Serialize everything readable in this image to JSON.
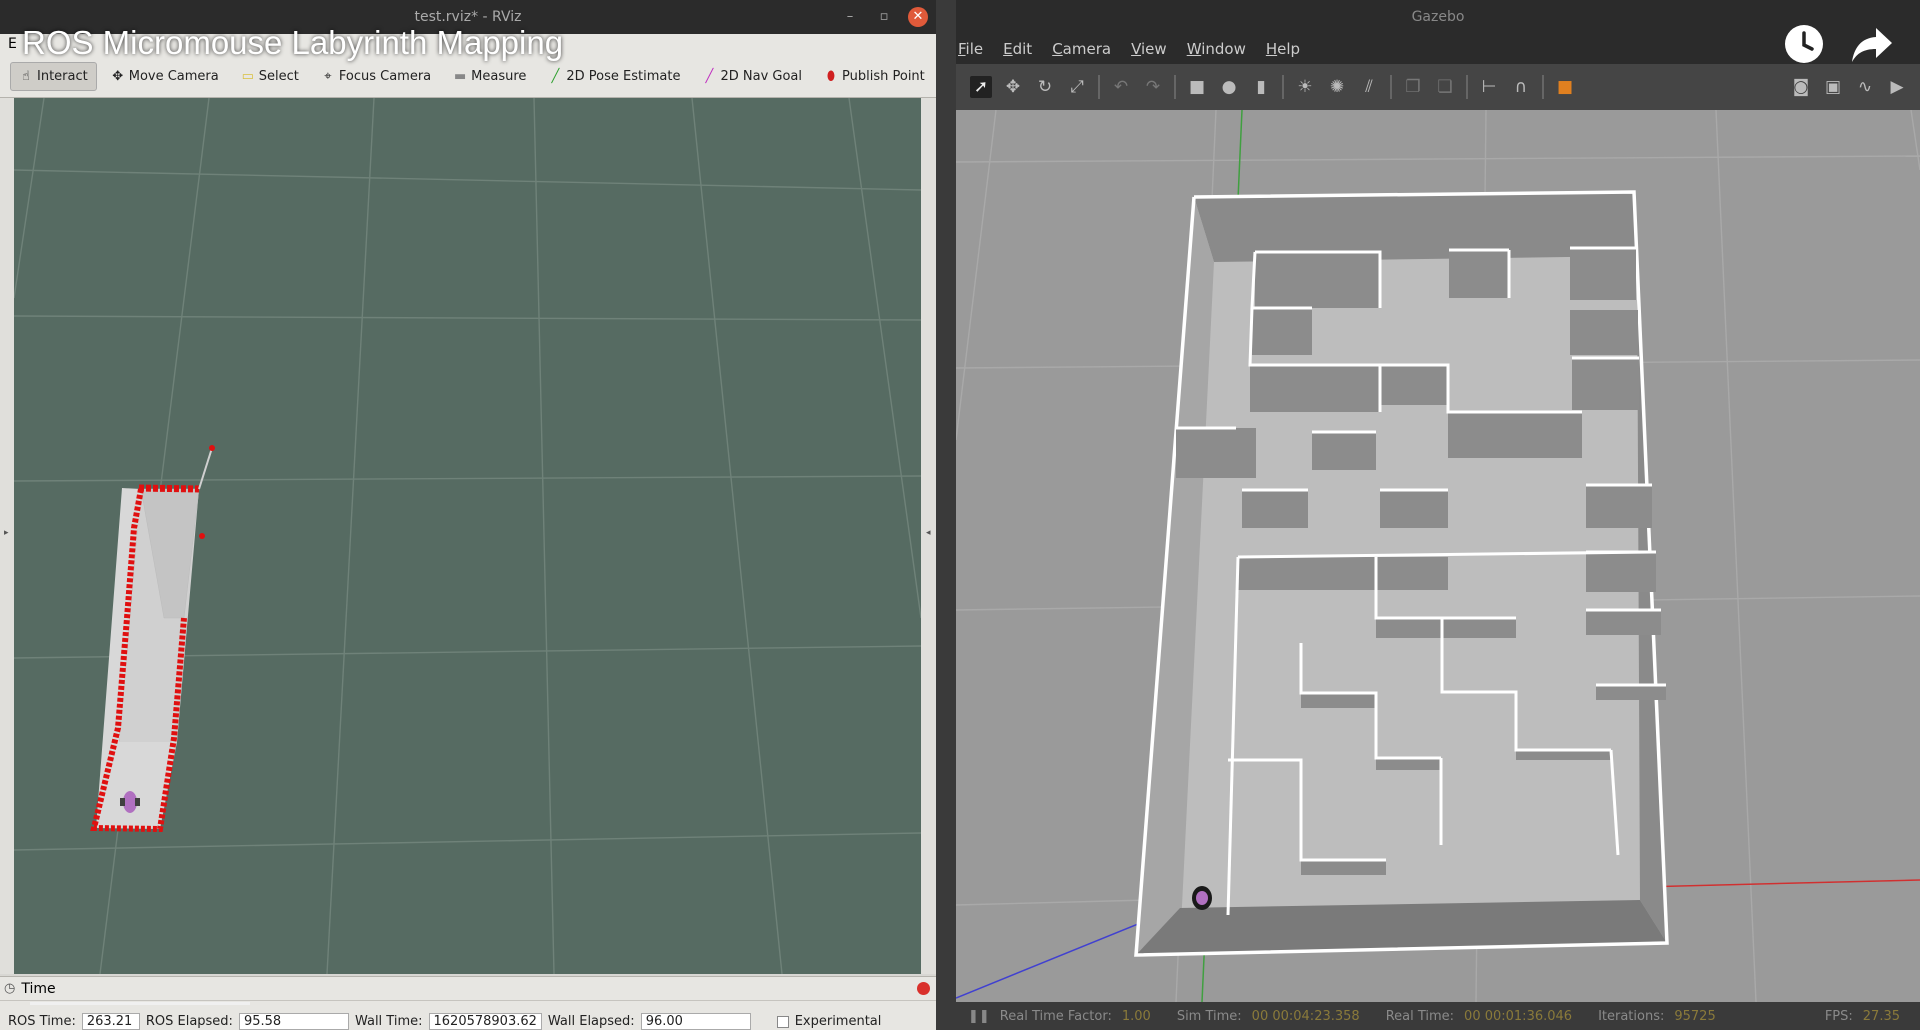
{
  "overlay": {
    "video_title": "ROS Micromouse Labyrinth Mapping",
    "watch_later_icon": "clock-icon",
    "share_icon": "share-arrow-icon"
  },
  "rviz": {
    "window_title": "test.rviz* - RViz",
    "menu_partial": "E",
    "toolbar": [
      {
        "label": "Interact",
        "icon": "hand-pointer-icon",
        "active": true
      },
      {
        "label": "Move Camera",
        "icon": "move-camera-icon"
      },
      {
        "label": "Select",
        "icon": "select-box-icon"
      },
      {
        "label": "Focus Camera",
        "icon": "focus-camera-icon"
      },
      {
        "label": "Measure",
        "icon": "ruler-icon"
      },
      {
        "label": "2D Pose Estimate",
        "icon": "green-arrow-icon"
      },
      {
        "label": "2D Nav Goal",
        "icon": "pink-arrow-icon"
      },
      {
        "label": "Publish Point",
        "icon": "map-pin-icon"
      }
    ],
    "time_panel": {
      "title": "Time",
      "ros_time_label": "ROS Time:",
      "ros_time": "263.21",
      "ros_elapsed_label": "ROS Elapsed:",
      "ros_elapsed": "95.58",
      "wall_time_label": "Wall Time:",
      "wall_time": "1620578903.62",
      "wall_elapsed_label": "Wall Elapsed:",
      "wall_elapsed": "96.00",
      "experimental_label": "Experimental"
    },
    "colors": {
      "viewport": "#566b62",
      "laser": "#e01010",
      "robot": "#b070c0"
    }
  },
  "gazebo": {
    "window_title": "Gazebo",
    "menu": [
      "File",
      "Edit",
      "Camera",
      "View",
      "Window",
      "Help"
    ],
    "status": {
      "rtf_label": "Real Time Factor:",
      "rtf": "1.00",
      "sim_label": "Sim Time:",
      "sim": "00 00:04:23.358",
      "real_label": "Real Time:",
      "real": "00 00:01:36.046",
      "iter_label": "Iterations:",
      "iter": "95725",
      "fps_label": "FPS:",
      "fps": "27.35"
    },
    "colors": {
      "ground": "#9a9a9a",
      "wall_top": "#ffffff",
      "wall_side": "#7c7c7c",
      "x_axis": "#d03030",
      "y_axis": "#40a040",
      "z_axis": "#4040d0"
    }
  }
}
